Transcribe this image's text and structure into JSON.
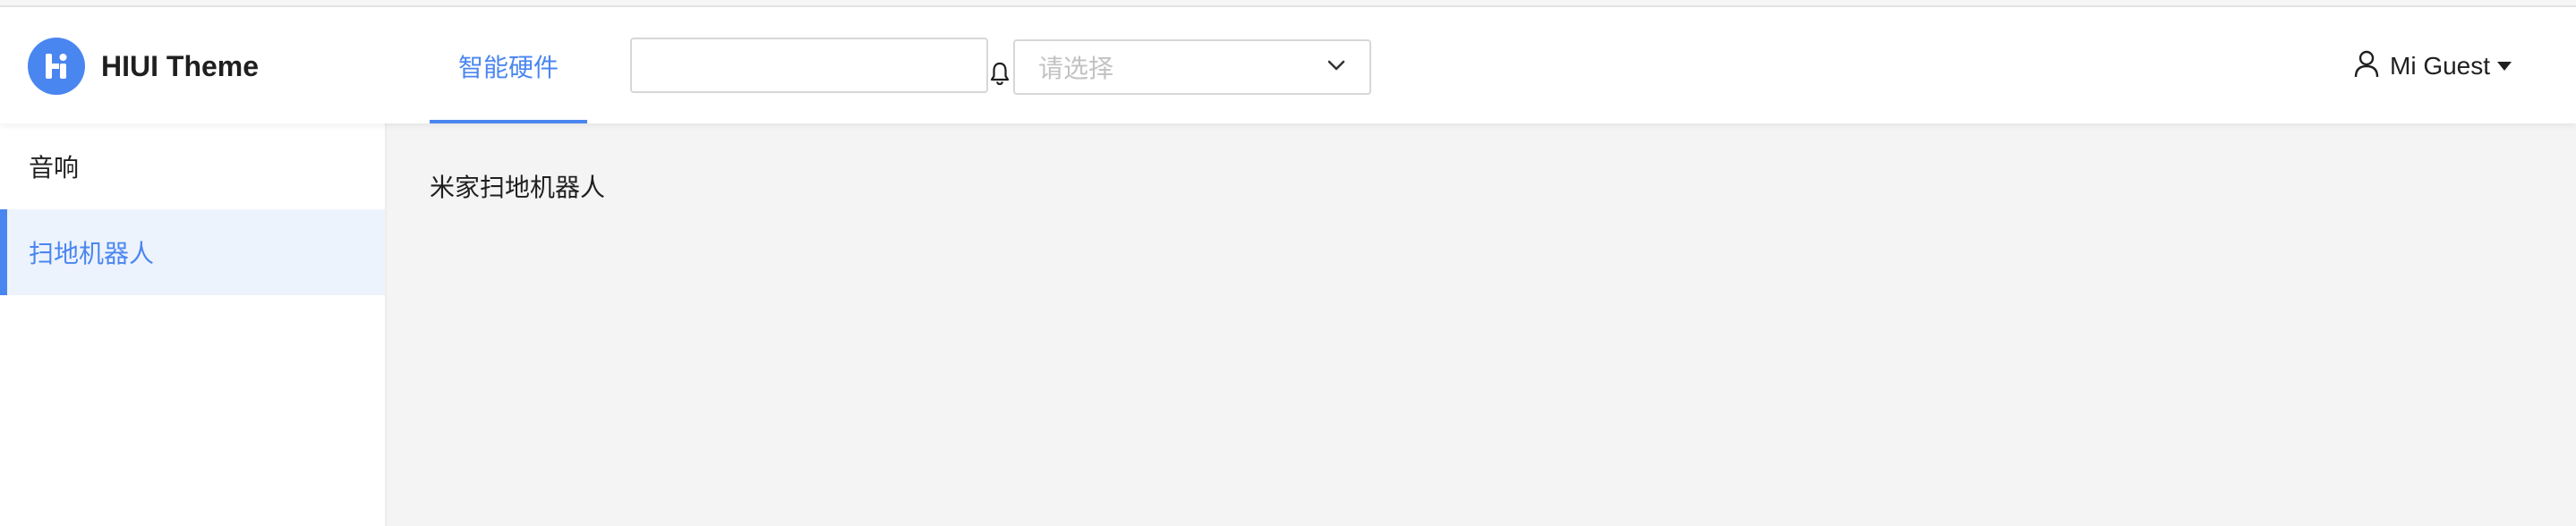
{
  "header": {
    "app_title": "HIUI Theme",
    "nav_tab_label": "智能硬件",
    "search": {
      "value": "",
      "placeholder": ""
    },
    "select": {
      "placeholder": "请选择"
    },
    "user_name": "Mi Guest"
  },
  "sidebar": {
    "items": [
      {
        "label": "音响",
        "active": false
      },
      {
        "label": "扫地机器人",
        "active": true
      }
    ]
  },
  "main": {
    "content_text": "米家扫地机器人"
  },
  "colors": {
    "accent": "#4a86f0",
    "active_bg": "#edf3fd",
    "content_bg": "#f4f4f4"
  },
  "icons": [
    "hiui-logo-icon",
    "bell-icon",
    "chevron-down-icon",
    "user-icon",
    "caret-down-icon"
  ]
}
